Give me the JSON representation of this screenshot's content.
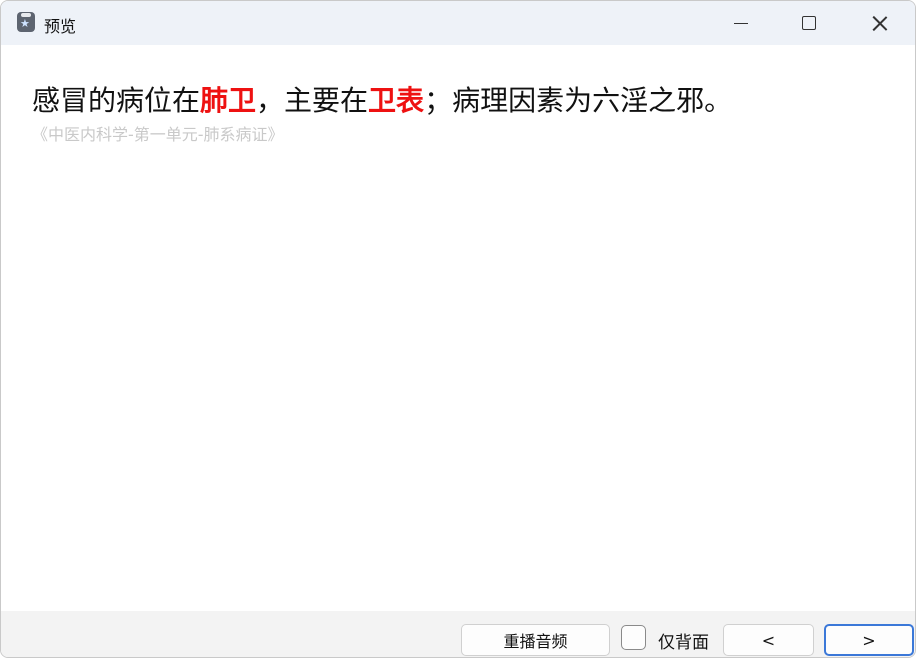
{
  "window": {
    "title": "预览",
    "app_icon": "card-app-icon",
    "controls": {
      "minimize_icon": "minimize-icon",
      "maximize_icon": "maximize-icon",
      "close_icon": "close-icon"
    }
  },
  "card": {
    "text_parts": [
      {
        "text": "感冒的病位在",
        "highlight": false
      },
      {
        "text": "肺卫",
        "highlight": true
      },
      {
        "text": "，主要在",
        "highlight": false
      },
      {
        "text": "卫表",
        "highlight": true
      },
      {
        "text": "；病理因素为六淫之邪。",
        "highlight": false
      }
    ],
    "source": "《中医内科学-第一单元-肺系病证》",
    "highlight_color": "#ee1111",
    "source_color": "#c9c9c9"
  },
  "toolbar": {
    "replay_label": "重播音频",
    "back_only_label": "仅背面",
    "back_only_checked": false,
    "prev_label": "<",
    "next_label": ">",
    "focus_color": "#3b78d8"
  }
}
